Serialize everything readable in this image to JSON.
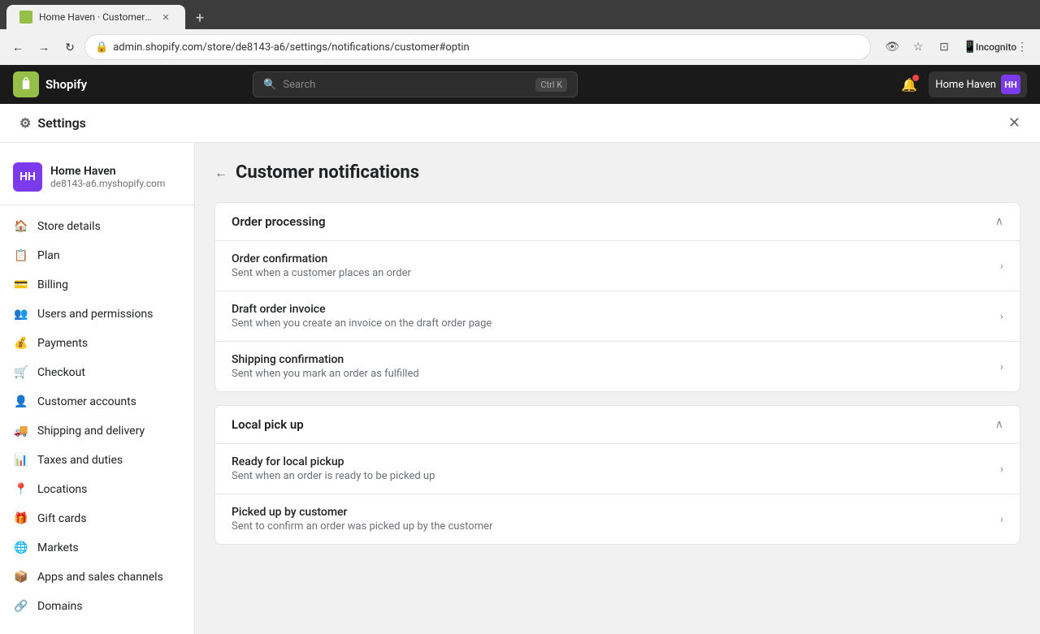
{
  "browser": {
    "tab_favicon_letter": "H",
    "tab_title": "Home Haven · Customer notific...",
    "tab_new_label": "+",
    "nav_back": "←",
    "nav_forward": "→",
    "nav_reload": "↻",
    "address_url": "admin.shopify.com/store/de8143-a6/settings/notifications/customer#optin",
    "incognito_label": "Incognito"
  },
  "topbar": {
    "logo_letters": "S",
    "search_placeholder": "Search",
    "search_shortcut": "Ctrl K",
    "store_name": "Home Haven",
    "store_letters": "HH"
  },
  "settings": {
    "title": "Settings",
    "close_icon": "✕"
  },
  "sidebar": {
    "store_name": "Home Haven",
    "store_domain": "de8143-a6.myshopify.com",
    "store_letters": "HH",
    "items": [
      {
        "id": "store-details",
        "label": "Store details",
        "icon": "🏠"
      },
      {
        "id": "plan",
        "label": "Plan",
        "icon": "📋"
      },
      {
        "id": "billing",
        "label": "Billing",
        "icon": "💳"
      },
      {
        "id": "users-and-permissions",
        "label": "Users and permissions",
        "icon": "👥"
      },
      {
        "id": "payments",
        "label": "Payments",
        "icon": "💰"
      },
      {
        "id": "checkout",
        "label": "Checkout",
        "icon": "🛒"
      },
      {
        "id": "customer-accounts",
        "label": "Customer accounts",
        "icon": "👤"
      },
      {
        "id": "shipping-and-delivery",
        "label": "Shipping and delivery",
        "icon": "🚚"
      },
      {
        "id": "taxes-and-duties",
        "label": "Taxes and duties",
        "icon": "📊"
      },
      {
        "id": "locations",
        "label": "Locations",
        "icon": "📍"
      },
      {
        "id": "gift-cards",
        "label": "Gift cards",
        "icon": "🎁"
      },
      {
        "id": "markets",
        "label": "Markets",
        "icon": "🌐"
      },
      {
        "id": "apps-and-sales-channels",
        "label": "Apps and sales channels",
        "icon": "📦"
      },
      {
        "id": "domains",
        "label": "Domains",
        "icon": "🔗"
      }
    ]
  },
  "page": {
    "back_icon": "←",
    "title": "Customer notifications"
  },
  "sections": [
    {
      "id": "order-processing",
      "title": "Order processing",
      "expanded": true,
      "items": [
        {
          "id": "order-confirmation",
          "title": "Order confirmation",
          "description": "Sent when a customer places an order"
        },
        {
          "id": "draft-order-invoice",
          "title": "Draft order invoice",
          "description": "Sent when you create an invoice on the draft order page"
        },
        {
          "id": "shipping-confirmation",
          "title": "Shipping confirmation",
          "description": "Sent when you mark an order as fulfilled"
        }
      ]
    },
    {
      "id": "local-pick-up",
      "title": "Local pick up",
      "expanded": true,
      "items": [
        {
          "id": "ready-for-local-pickup",
          "title": "Ready for local pickup",
          "description": "Sent when an order is ready to be picked up"
        },
        {
          "id": "picked-up-by-customer",
          "title": "Picked up by customer",
          "description": "Sent to confirm an order was picked up by the customer"
        }
      ]
    }
  ]
}
